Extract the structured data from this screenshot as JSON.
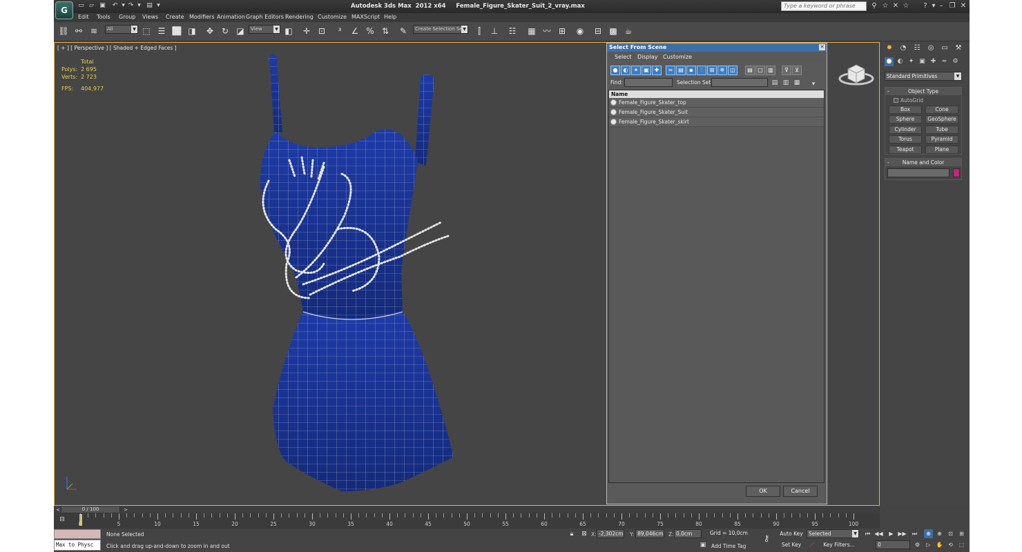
{
  "app": {
    "title": "Autodesk 3ds Max  2012 x64     Female_Figure_Skater_Suit_2_vray.max",
    "logo_text": "G",
    "search_placeholder": "Type a keyword or phrase",
    "quick_access_icons": [
      "new-file-icon",
      "open-file-icon",
      "save-icon",
      "undo-icon",
      "undo-dropdown-icon",
      "redo-icon",
      "redo-dropdown-icon",
      "project-folder-icon",
      "dropdown-icon"
    ],
    "titlebar_icons": [
      "binoculars-icon",
      "star-icon",
      "exchange-icon",
      "help-icon",
      "minimize-icon",
      "restore-icon",
      "close-icon"
    ]
  },
  "menu": [
    "Edit",
    "Tools",
    "Group",
    "Views",
    "Create",
    "Modifiers",
    "Animation",
    "Graph Editors",
    "Rendering",
    "Customize",
    "MAXScript",
    "Help"
  ],
  "toolbar": {
    "selection_filter": "All",
    "reference_coord": "View",
    "named_selection": "Create Selection Se"
  },
  "viewport": {
    "label": "[ + ] [ Perspective ] [ Shaded + Edged Faces ]",
    "stats": {
      "total_label": "Total",
      "polys_label": "Polys:",
      "polys_value": "2 695",
      "verts_label": "Verts:",
      "verts_value": "2 723",
      "fps_label": "FPS:",
      "fps_value": "404,977"
    },
    "colors": {
      "dress": "#1e3b9e",
      "mesh_lines": "#b8b8c8",
      "gems": "#e8e8e8",
      "stats": "#e8d24a",
      "active_border": "#e7b446"
    }
  },
  "dialog": {
    "title": "Select From Scene",
    "menu": [
      "Select",
      "Display",
      "Customize"
    ],
    "find_label": "Find:",
    "selection_set_label": "Selection Set:",
    "column_header": "Name",
    "objects": [
      "Female_Figure_Skater_top",
      "Female_Figure_Skater_Suit",
      "Female_Figure_Skater_skirt"
    ],
    "ok": "OK",
    "cancel": "Cancel"
  },
  "command_panel": {
    "category": "Standard Primitives",
    "object_type_title": "Object Type",
    "autogrid_label": "AutoGrid",
    "buttons": [
      "Box",
      "Cone",
      "Sphere",
      "GeoSphere",
      "Cylinder",
      "Tube",
      "Torus",
      "Pyramid",
      "Teapot",
      "Plane"
    ],
    "name_color_title": "Name and Color",
    "object_color": "#c2257e"
  },
  "timeline": {
    "slider_label": "0 / 100",
    "ticks": [
      "0",
      "5",
      "10",
      "15",
      "20",
      "25",
      "30",
      "35",
      "40",
      "45",
      "50",
      "55",
      "60",
      "65",
      "70",
      "75",
      "80",
      "85",
      "90",
      "95",
      "100"
    ]
  },
  "status": {
    "maxscript_text": "Max to Physc",
    "selection_status": "None Selected",
    "prompt": "Click and drag up-and-down to zoom in and out",
    "x_label": "X:",
    "x_value": "-2,302cm",
    "y_label": "Y:",
    "y_value": "89,046cm",
    "z_label": "Z:",
    "z_value": "0,0cm",
    "grid": "Grid = 10,0cm",
    "add_time_tag": "Add Time Tag",
    "auto_key": "Auto Key",
    "set_key": "Set Key",
    "key_mode": "Selected",
    "key_filters": "Key Filters...",
    "current_frame": "0"
  }
}
